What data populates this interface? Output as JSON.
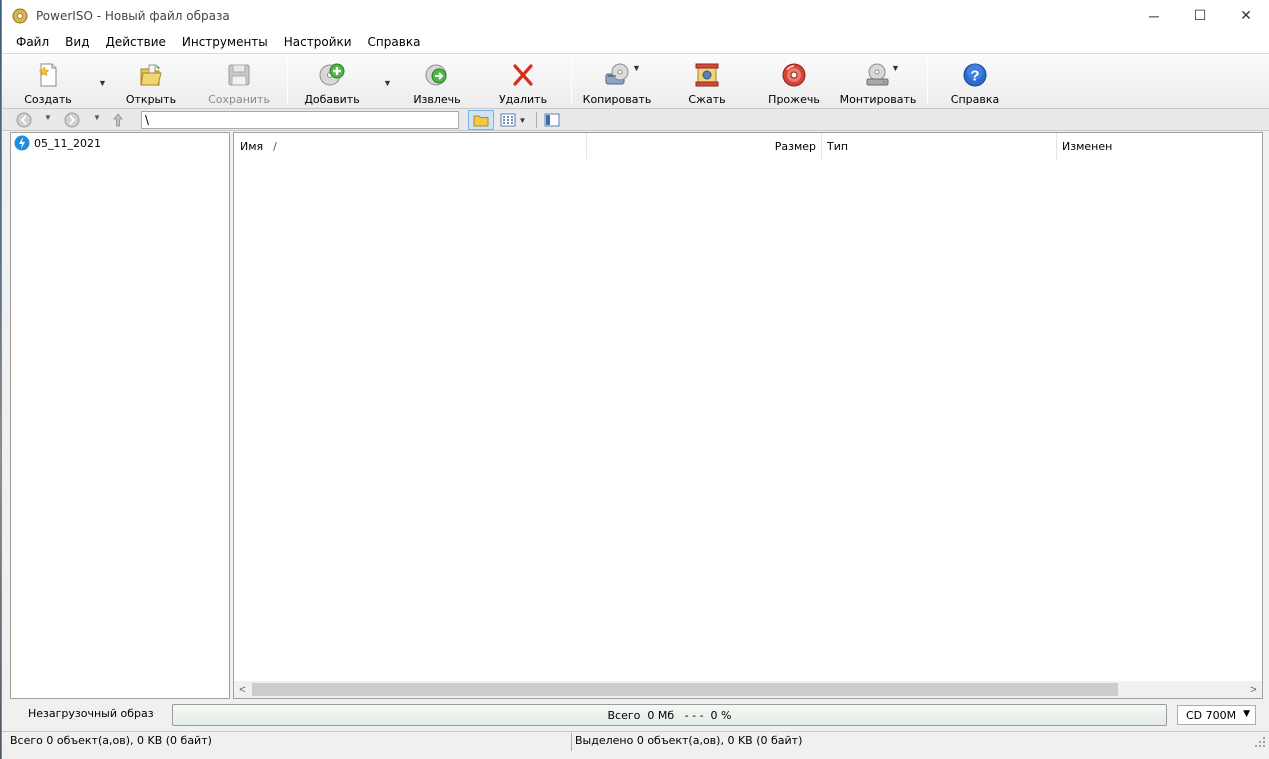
{
  "window": {
    "title": "PowerISO - Новый файл образа",
    "minimize": "─",
    "maximize": "☐",
    "close": "✕"
  },
  "menu": [
    "Файл",
    "Вид",
    "Действие",
    "Инструменты",
    "Настройки",
    "Справка"
  ],
  "toolbar": {
    "create": "Создать",
    "open": "Открыть",
    "save": "Сохранить",
    "add": "Добавить",
    "extract": "Извлечь",
    "delete": "Удалить",
    "copy": "Копировать",
    "compress": "Сжать",
    "burn": "Прожечь",
    "mount": "Монтировать",
    "help": "Справка"
  },
  "address": {
    "path": "\\"
  },
  "tree": {
    "root": "05_11_2021"
  },
  "list": {
    "columns": {
      "name": "Имя",
      "sort_indicator": "/",
      "size": "Размер",
      "type": "Тип",
      "modified": "Изменен"
    }
  },
  "status": {
    "boot": "Незагрузочный образ",
    "progress_text": "Всего  0 Мб   - - -  0 %",
    "disk_type": "CD 700M",
    "total": "Всего 0 объект(а,ов), 0 KB (0 байт)",
    "selected": "Выделено 0 объект(а,ов), 0 KB (0 байт)"
  }
}
